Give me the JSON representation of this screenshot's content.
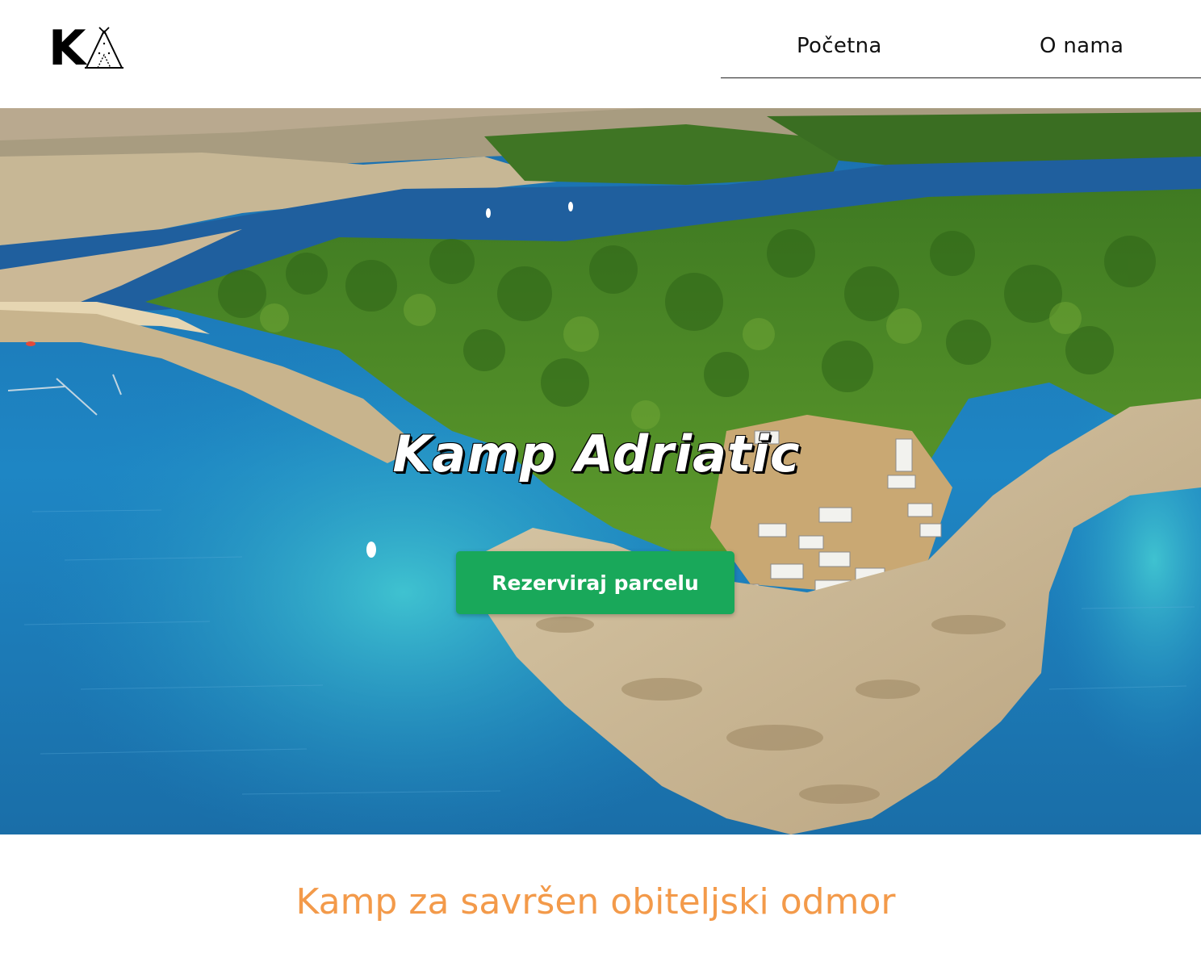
{
  "brand": {
    "logo_text": "K",
    "logo_icon": "teepee-tent-icon"
  },
  "nav": {
    "items": [
      {
        "label": "Početna"
      },
      {
        "label": "O nama"
      }
    ]
  },
  "hero": {
    "title": "Kamp Adriatic",
    "cta_label": "Rezerviraj parcelu",
    "image_subject": "aerial coastline campsite photo"
  },
  "intro": {
    "heading": "Kamp za savršen obiteljski odmor"
  },
  "colors": {
    "accent_green": "#19a85a",
    "heading_orange": "#f39a4a",
    "sea_blue": "#1b78b8",
    "forest_green": "#4e8c2a"
  }
}
